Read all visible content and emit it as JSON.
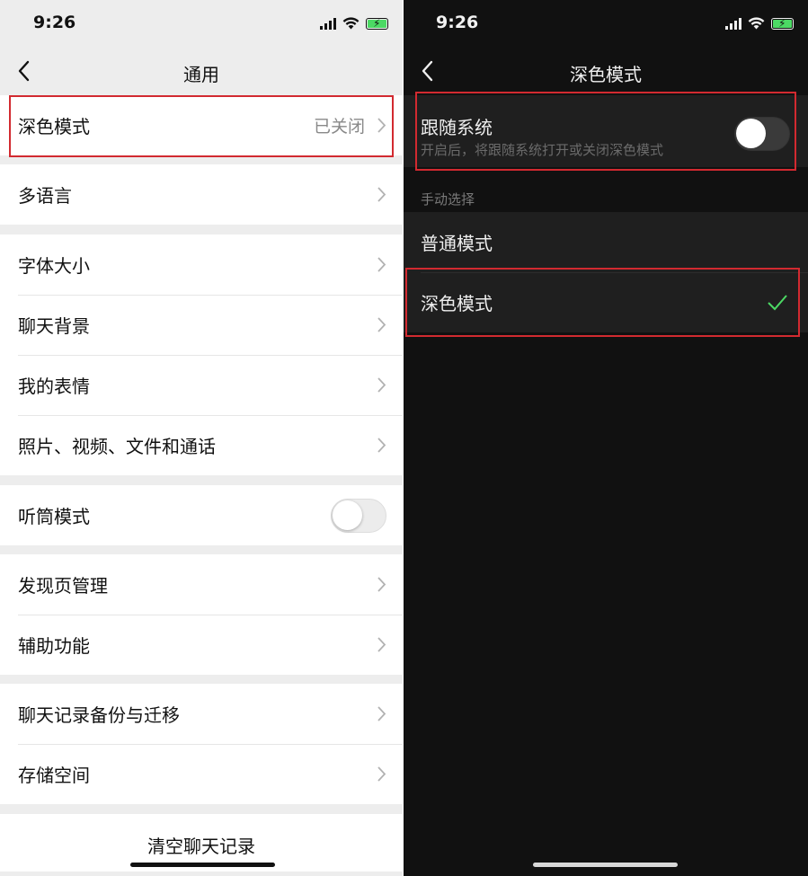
{
  "status_bar": {
    "time": "9:26"
  },
  "general": {
    "title": "通用",
    "dark_mode_row": {
      "label": "深色模式",
      "value": "已关闭"
    },
    "groups": [
      {
        "items": [
          "多语言"
        ]
      },
      {
        "items": [
          "字体大小",
          "聊天背景",
          "我的表情",
          "照片、视频、文件和通话"
        ]
      },
      {
        "items": [
          "听筒模式"
        ]
      },
      {
        "items": [
          "发现页管理",
          "辅助功能"
        ]
      },
      {
        "items": [
          "聊天记录备份与迁移",
          "存储空间"
        ]
      }
    ],
    "clear_button": "清空聊天记录"
  },
  "dark_mode": {
    "title": "深色模式",
    "follow_system": {
      "label": "跟随系统",
      "description": "开启后，将跟随系统打开或关闭深色模式",
      "enabled": false
    },
    "section_header": "手动选择",
    "options": [
      {
        "label": "普通模式",
        "selected": false
      },
      {
        "label": "深色模式",
        "selected": true
      }
    ]
  },
  "colors": {
    "highlight": "#d22a30",
    "check": "#4cd964",
    "battery": "#4cd964"
  },
  "icons": [
    "back-arrow-icon",
    "chevron-right-icon",
    "checkmark-icon",
    "signal-icon",
    "wifi-icon",
    "battery-icon"
  ]
}
